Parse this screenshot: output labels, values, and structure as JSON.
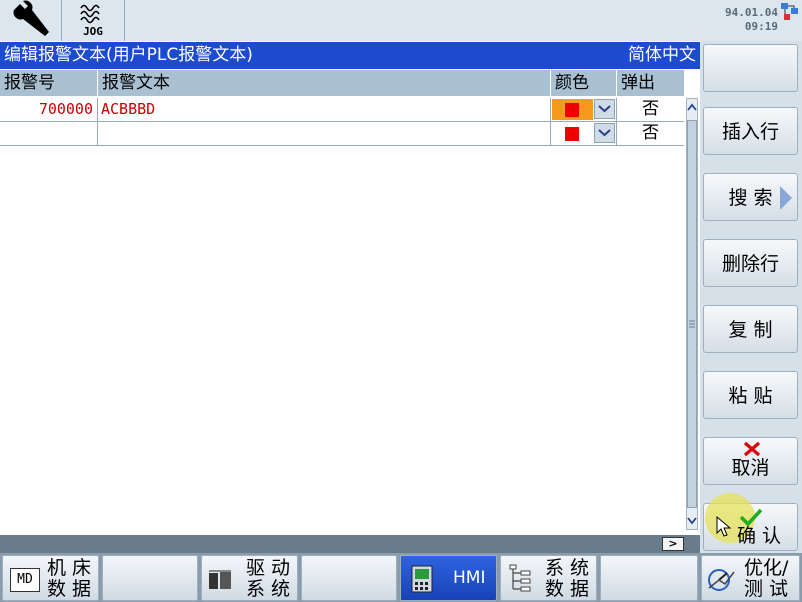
{
  "header": {
    "date": "94.01.04",
    "time": "09:19",
    "jog_label": "JOG"
  },
  "title": {
    "text": "编辑报警文本(用户PLC报警文本)",
    "language": "简体中文"
  },
  "table": {
    "columns": [
      "报警号",
      "报警文本",
      "颜色",
      "弹出"
    ],
    "rows": [
      {
        "number": "700000",
        "text": "ACBBBD",
        "popup": "否",
        "selected": true
      },
      {
        "number": "",
        "text": "",
        "popup": "否",
        "selected": false
      }
    ]
  },
  "softkeys_right": {
    "insert_row": "插入行",
    "search": "搜 索",
    "delete_row": "删除行",
    "copy": "复 制",
    "paste": "粘 贴",
    "cancel": "取消",
    "confirm": "确 认"
  },
  "softkeys_bottom": {
    "machine_data_1": "机 床",
    "machine_data_2": "数 据",
    "md_icon_text": "MD",
    "drive_1": "驱 动",
    "drive_2": "系 统",
    "hmi": "HMI",
    "sysdata_1": "系 统",
    "sysdata_2": "数 据",
    "opt_1": "优化/",
    "opt_2": "测 试"
  },
  "scroll_right_label": ">",
  "colors": {
    "title_bg": "#1c4bd0",
    "header_bg": "#a9c0d2",
    "selected_color_cell": "#f59a1d",
    "alarm_text": "#cc0000",
    "hmi_active": "#1c4bd0"
  }
}
